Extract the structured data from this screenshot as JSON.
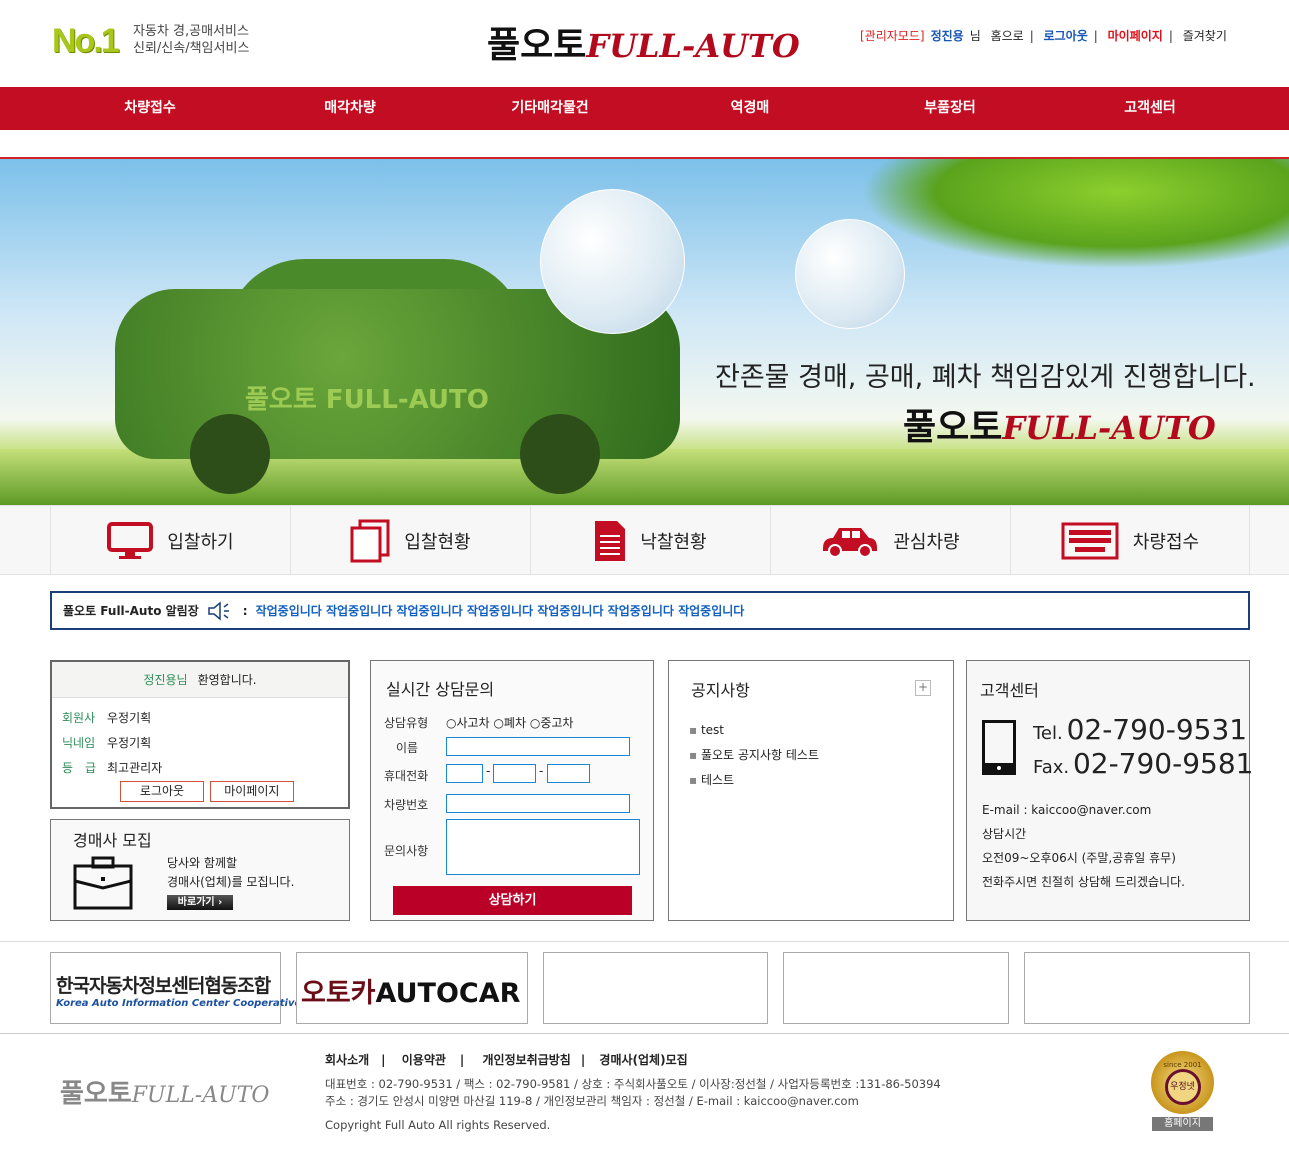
{
  "header": {
    "no1": "No.1",
    "slogan": [
      "자동차 경,공매서비스",
      "신뢰/신속/책임서비스"
    ],
    "logo_ko": "풀오토",
    "logo_en": "FULL-AUTO",
    "links": [
      {
        "label": "[관리자모드]",
        "color": "#e02020"
      },
      {
        "label": "정진용",
        "color": "#1656b8"
      },
      {
        "label": "님",
        "color": "#333"
      },
      {
        "label": "홈으로",
        "color": "#333"
      },
      {
        "label": "로그아웃",
        "color": "#1656b8"
      },
      {
        "label": "마이페이지",
        "color": "#e0101a"
      },
      {
        "label": "즐겨찾기",
        "color": "#333"
      }
    ]
  },
  "nav": [
    "차량접수",
    "매각차량",
    "기타매각물건",
    "역경매",
    "부품장터",
    "고객센터"
  ],
  "banner": {
    "car_text": "풀오토 FULL-AUTO",
    "headline": "잔존물 경매, 공매, 폐차 책임감있게 진행합니다.",
    "logo_ko": "풀오토",
    "logo_en": "FULL-AUTO"
  },
  "quick": [
    {
      "label": "입찰하기",
      "icon": "monitor-icon"
    },
    {
      "label": "입찰현황",
      "icon": "documents-icon"
    },
    {
      "label": "낙찰현황",
      "icon": "list-document-icon"
    },
    {
      "label": "관심차량",
      "icon": "car-icon"
    },
    {
      "label": "차량접수",
      "icon": "keyboard-icon"
    }
  ],
  "notice_bar": {
    "title": "풀오토 Full-Auto 알림장",
    "colon": ":",
    "message": "작업중입니다 작업중입니다 작업중입니다 작업중입니다 작업중입니다 작업중입니다 작업중입니다"
  },
  "login": {
    "name": "정진용님",
    "welcome": "환영합니다.",
    "rows": [
      {
        "k": "회원사",
        "v": "우정기획"
      },
      {
        "k": "닉네임",
        "v": "우정기획"
      },
      {
        "k": "등　급",
        "v": "최고관리자"
      }
    ],
    "logout": "로그아웃",
    "mypage": "마이페이지"
  },
  "recruit": {
    "title": "경매사 모집",
    "line1": "당사와 함께할",
    "line2": "경매사(업체)를 모집니다.",
    "button": "바로가기 ›"
  },
  "consult": {
    "title": "실시간 상담문의",
    "type_label": "상담유형",
    "types": [
      "사고차",
      "폐차",
      "중고차"
    ],
    "name_label": "이름",
    "phone_label": "휴대전화",
    "dash": "-",
    "car_label": "차량번호",
    "inquiry_label": "문의사항",
    "submit": "상담하기"
  },
  "notices": {
    "title": "공지사항",
    "more": "+",
    "items": [
      "test",
      "풀오토 공지사항 테스트",
      "테스트"
    ]
  },
  "cs": {
    "title": "고객센터",
    "tel_label": "Tel.",
    "tel": "02-790-9531",
    "fax_label": "Fax.",
    "fax": "02-790-9581",
    "email": "E-mail : kaiccoo@naver.com",
    "hours_title": "상담시간",
    "hours": "오전09~오후06시 (주말,공휴일 휴무)",
    "note": "전화주시면 친절히 상담해 드리겠습니다."
  },
  "partners": [
    {
      "ko": "한국자동차정보센터협동조합",
      "en": "Korea Auto Information Center Cooperative"
    },
    {
      "ko": "오토카",
      "en": "AUTOCAR"
    }
  ],
  "footer": {
    "logo_ko": "풀오토",
    "logo_en": "FULL-AUTO",
    "links": [
      "회사소개",
      "이용약관",
      "개인정보취급방침",
      "경매사(업체)모집"
    ],
    "info1": "대표번호 : 02-790-9531 / 팩스 : 02-790-9581 / 상호 : 주식회사풀오토 / 이사장:정선철 / 사업자등록번호 :131-86-50394",
    "info2": "주소 : 경기도 안성시 미양면 마산길 119-8 / 개인정보관리 책임자 : 정선철 / E-mail : kaiccoo@naver.com",
    "copyright": "Copyright Full Auto All rights Reserved.",
    "badge_since": "since 2001",
    "badge_name": "우정넷",
    "badge_label": "홈페이지"
  }
}
